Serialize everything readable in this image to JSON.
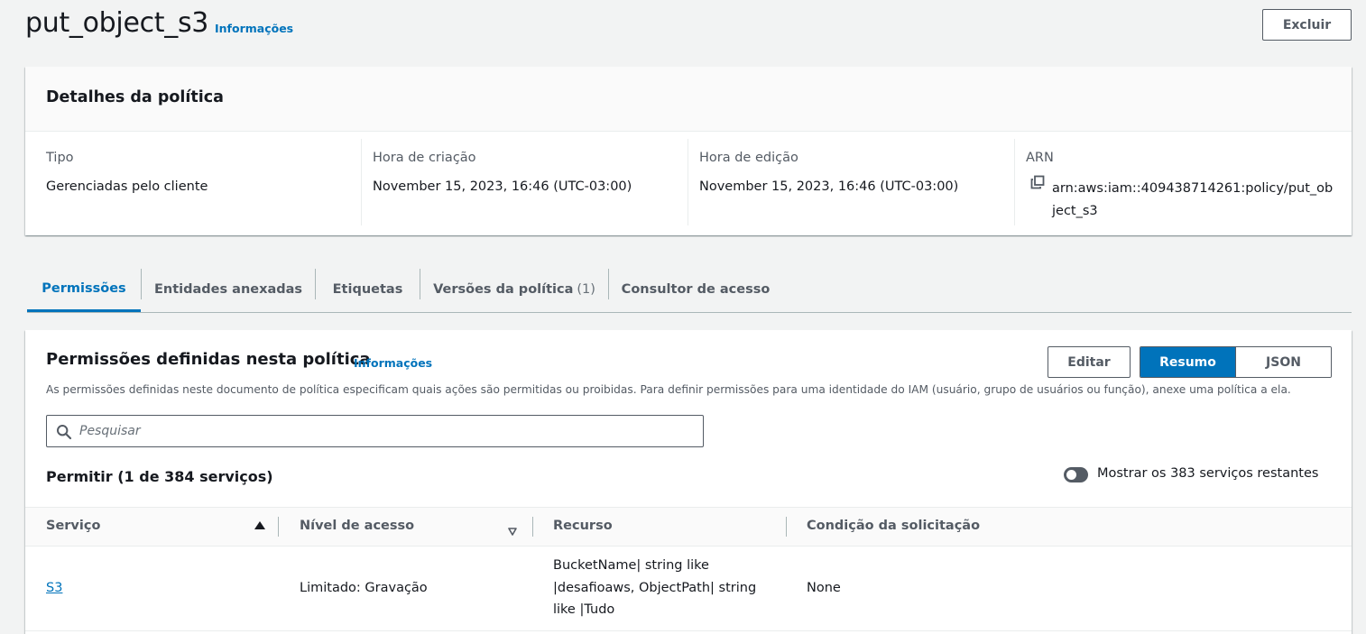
{
  "header": {
    "title": "put_object_s3",
    "info_label": "Informações",
    "delete_label": "Excluir"
  },
  "details": {
    "heading": "Detalhes da política",
    "type_label": "Tipo",
    "type_value": "Gerenciadas pelo cliente",
    "created_label": "Hora de criação",
    "created_value": "November 15, 2023, 16:46 (UTC-03:00)",
    "edited_label": "Hora de edição",
    "edited_value": "November 15, 2023, 16:46 (UTC-03:00)",
    "arn_label": "ARN",
    "arn_line1": "arn:aws:iam::409438714261:policy/put_ob",
    "arn_line2": "ject_s3"
  },
  "tabs": [
    {
      "label": "Permissões",
      "active": true
    },
    {
      "label": "Entidades anexadas"
    },
    {
      "label": "Etiquetas"
    },
    {
      "label": "Versões da política",
      "count": "(1)"
    },
    {
      "label": "Consultor de acesso"
    }
  ],
  "permissions": {
    "title": "Permissões definidas nesta política",
    "info_label": "Informações",
    "description": "As permissões definidas neste documento de política especificam quais ações são permitidas ou proibidas. Para definir permissões para uma identidade do IAM (usuário, grupo de usuários ou função), anexe uma política a ela.",
    "edit_label": "Editar",
    "view_summary": "Resumo",
    "view_json": "JSON",
    "search_placeholder": "Pesquisar",
    "search_value": "",
    "allow_title": "Permitir (1 de 384 serviços)",
    "toggle_label": "Mostrar os 383 serviços restantes",
    "toggle_on": false,
    "columns": [
      "Serviço",
      "Nível de acesso",
      "Recurso",
      "Condição da solicitação"
    ],
    "rows": [
      {
        "service": "S3",
        "access_level": "Limitado: Gravação",
        "resource_lines": [
          "BucketName| string like",
          "|desafioaws, ObjectPath| string",
          "like |Tudo"
        ],
        "condition": "None"
      }
    ]
  },
  "colors": {
    "accent": "#0073bb",
    "background": "#f2f3f3",
    "text": "#16191f",
    "muted": "#545b64"
  }
}
